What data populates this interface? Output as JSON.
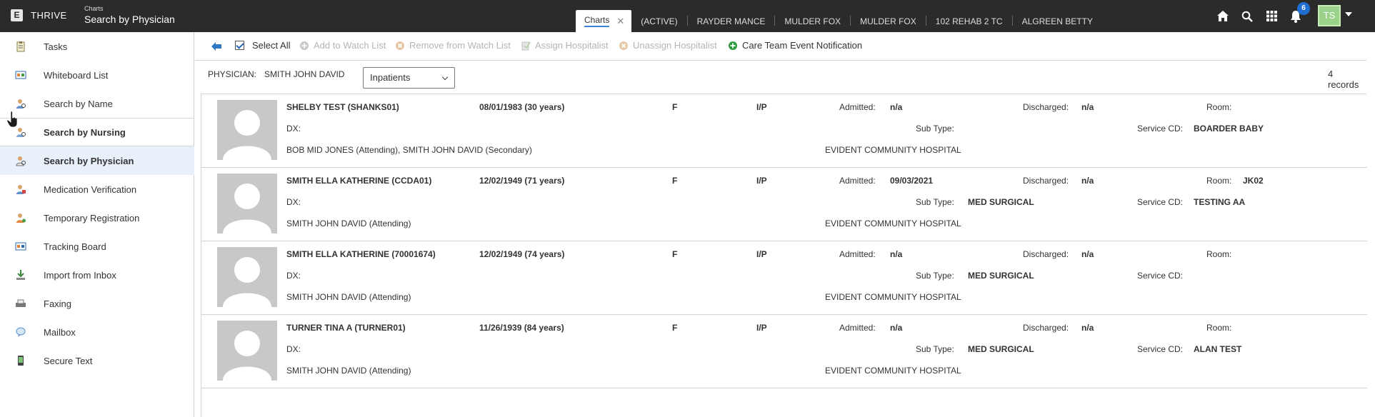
{
  "app": {
    "logo_letter": "E",
    "brand": "THRIVE",
    "section": "Charts",
    "title": "Search by Physician"
  },
  "tabs": [
    {
      "label": "Charts",
      "active": true
    },
    {
      "label": "(ACTIVE)"
    },
    {
      "label": "RAYDER MANCE"
    },
    {
      "label": "MULDER FOX"
    },
    {
      "label": "MULDER FOX"
    },
    {
      "label": "102 REHAB 2 TC"
    },
    {
      "label": "ALGREEN BETTY"
    }
  ],
  "top_icons": {
    "notifications_count": "6",
    "avatar_initials": "TS"
  },
  "sidebar": {
    "items": [
      {
        "label": "Tasks",
        "icon": "tasks-icon"
      },
      {
        "label": "Whiteboard List",
        "icon": "whiteboard-icon"
      },
      {
        "label": "Search by Name",
        "icon": "person-search-icon"
      },
      {
        "label": "Search by Nursing",
        "icon": "nurse-search-icon"
      },
      {
        "label": "Search by Physician",
        "icon": "physician-search-icon"
      },
      {
        "label": "Medication Verification",
        "icon": "medication-icon"
      },
      {
        "label": "Temporary Registration",
        "icon": "registration-icon"
      },
      {
        "label": "Tracking Board",
        "icon": "tracking-board-icon"
      },
      {
        "label": "Import from Inbox",
        "icon": "import-icon"
      },
      {
        "label": "Faxing",
        "icon": "fax-icon"
      },
      {
        "label": "Mailbox",
        "icon": "mailbox-icon"
      },
      {
        "label": "Secure Text",
        "icon": "secure-text-icon"
      }
    ]
  },
  "toolbar": {
    "select_all": "Select All",
    "add_watch": "Add to Watch List",
    "remove_watch": "Remove from Watch List",
    "assign_hosp": "Assign Hospitalist",
    "unassign_hosp": "Unassign Hospitalist",
    "care_team": "Care Team Event Notification"
  },
  "filter": {
    "physician_label": "PHYSICIAN:",
    "physician_value": "SMITH JOHN DAVID",
    "select_value": "Inpatients",
    "records": "4 records"
  },
  "labels": {
    "admitted": "Admitted:",
    "discharged": "Discharged:",
    "room": "Room:",
    "dx": "DX:",
    "sub_type": "Sub Type:",
    "service_cd": "Service CD:"
  },
  "patients": [
    {
      "name": "SHELBY TEST (SHANKS01)",
      "dob": "08/01/1983 (30 years)",
      "sex": "F",
      "status": "I/P",
      "admitted": "n/a",
      "discharged": "n/a",
      "room": "",
      "sub_type": "",
      "service_cd": "BOARDER BABY",
      "physicians": "BOB MID JONES (Attending), SMITH JOHN DAVID (Secondary)",
      "facility": "EVIDENT COMMUNITY HOSPITAL"
    },
    {
      "name": "SMITH ELLA KATHERINE (CCDA01)",
      "dob": "12/02/1949 (71 years)",
      "sex": "F",
      "status": "I/P",
      "admitted": "09/03/2021",
      "discharged": "n/a",
      "room": "JK02",
      "sub_type": "MED SURGICAL",
      "service_cd": "TESTING AA",
      "physicians": "SMITH JOHN DAVID (Attending)",
      "facility": "EVIDENT COMMUNITY HOSPITAL"
    },
    {
      "name": "SMITH ELLA KATHERINE (70001674)",
      "dob": "12/02/1949 (74 years)",
      "sex": "F",
      "status": "I/P",
      "admitted": "n/a",
      "discharged": "n/a",
      "room": "",
      "sub_type": "MED SURGICAL",
      "service_cd": "",
      "physicians": "SMITH JOHN DAVID (Attending)",
      "facility": "EVIDENT COMMUNITY HOSPITAL"
    },
    {
      "name": "TURNER TINA A (TURNER01)",
      "dob": "11/26/1939 (84 years)",
      "sex": "F",
      "status": "I/P",
      "admitted": "n/a",
      "discharged": "n/a",
      "room": "",
      "sub_type": "MED SURGICAL",
      "service_cd": "ALAN TEST",
      "physicians": "SMITH JOHN DAVID (Attending)",
      "facility": "EVIDENT COMMUNITY HOSPITAL"
    }
  ],
  "colors": {
    "topbar": "#2b2b2b",
    "selected_row": "#e8f0fa",
    "accent": "#3a85d6",
    "badge": "#1e6fd1",
    "avatar": "#9bd18a",
    "care_team_icon": "#2e9a3a"
  }
}
